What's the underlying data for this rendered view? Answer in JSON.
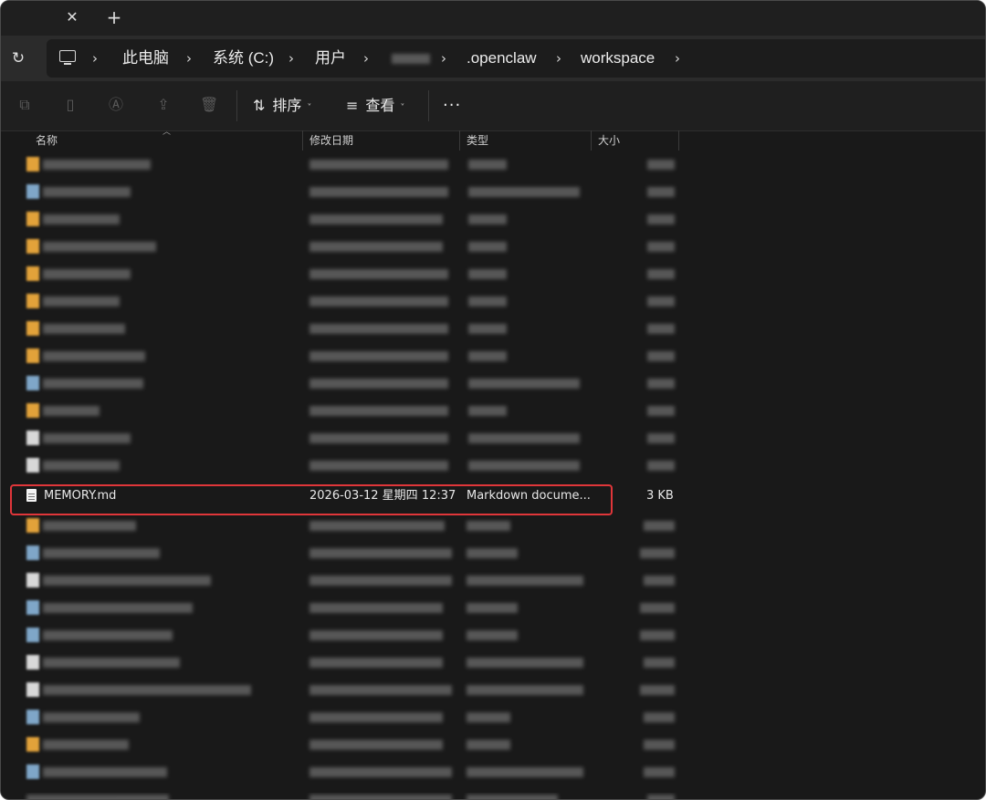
{
  "tabstrip": {
    "close_glyph": "✕",
    "new_glyph": "+"
  },
  "address": {
    "refresh_glyph": "↻",
    "crumbs": [
      "此电脑",
      "系统 (C:)",
      "用户",
      ".openclaw",
      "workspace"
    ],
    "chevron": "›"
  },
  "toolbar": {
    "sort_label": "排序",
    "view_label": "查看",
    "more_label": "···",
    "icons": [
      "copy-icon",
      "paste-icon",
      "rename-icon",
      "share-icon",
      "delete-icon"
    ]
  },
  "columns": {
    "name": "名称",
    "modified": "修改日期",
    "type": "类型",
    "size": "大小"
  },
  "highlighted_file": {
    "name": "MEMORY.md",
    "modified": "2026-03-12 星期四 12:37",
    "type": "Markdown docume...",
    "size": "3 KB"
  },
  "colors": {
    "highlight_border": "#e0363a",
    "folder": "#e2a23a",
    "background": "#191919"
  }
}
